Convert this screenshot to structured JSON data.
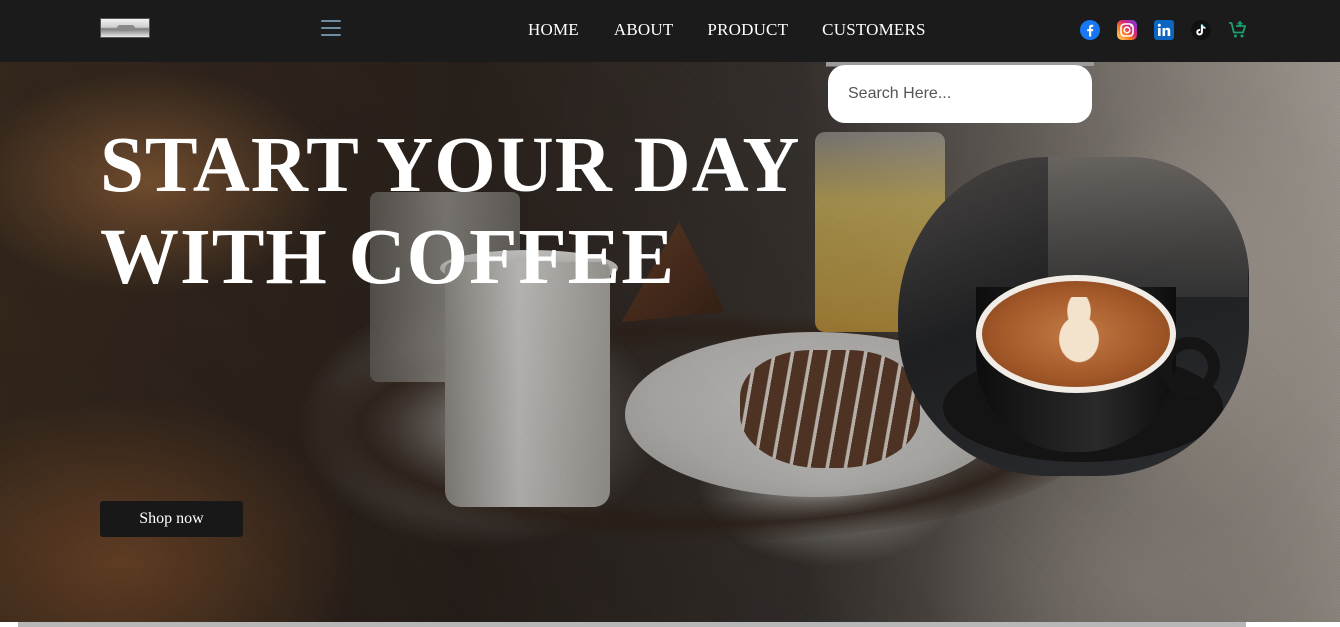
{
  "header": {
    "nav": [
      "HOME",
      "ABOUT",
      "PRODUCT",
      "CUSTOMERS"
    ],
    "socials": [
      "facebook-icon",
      "instagram-icon",
      "linkedin-icon",
      "tiktok-icon",
      "cart-plus-icon"
    ]
  },
  "search": {
    "placeholder": "Search Here..."
  },
  "hero": {
    "title_line1": "START YOUR DAY",
    "title_line2": "WITH COFFEE",
    "button_label": "Shop now"
  },
  "colors": {
    "navbar": "#1b1b1b",
    "hamburger": "#6f8da3",
    "button": "#181818",
    "facebook": "#1877f2",
    "linkedin": "#0a66c2",
    "cart": "#1aa06d"
  }
}
